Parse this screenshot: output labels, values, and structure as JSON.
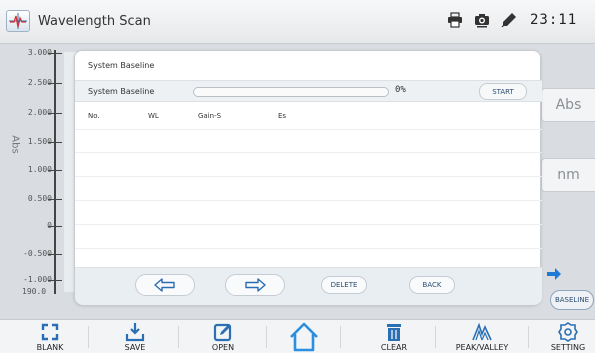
{
  "title_bar": {
    "app_title": "Wavelength Scan",
    "clock": "23:11",
    "status_icons": [
      "printer-icon",
      "camera-icon",
      "pen-icon"
    ]
  },
  "plot": {
    "y_axis_title": "Abs",
    "y_ticks": [
      "3.000",
      "2.500",
      "2.000",
      "1.500",
      "1.000",
      "0.500",
      "0",
      "-0.500",
      "-1.000"
    ],
    "x_tick_start": "190.0"
  },
  "side_panel": {
    "abs_box": "Abs",
    "nm_box": "nm",
    "baseline_button": "BASELINE",
    "arrow_icon": "arrow-right-icon"
  },
  "dialog": {
    "title": "System Baseline",
    "row_label": "System Baseline",
    "progress_percent": 0,
    "progress_text": "0%",
    "start_button": "START",
    "columns": [
      "No.",
      "WL",
      "Gain-S",
      "Es"
    ],
    "rows": [],
    "footer": {
      "prev_icon": "arrow-left-icon",
      "next_icon": "arrow-right-icon",
      "delete_button": "DELETE",
      "back_button": "BACK"
    }
  },
  "toolbar": {
    "items": [
      {
        "label": "BLANK",
        "icon": "blank-icon"
      },
      {
        "label": "SAVE",
        "icon": "save-icon"
      },
      {
        "label": "OPEN",
        "icon": "open-icon"
      },
      {
        "label": "",
        "icon": "home-icon"
      },
      {
        "label": "CLEAR",
        "icon": "trash-icon"
      },
      {
        "label": "PEAK/VALLEY",
        "icon": "peak-valley-icon"
      },
      {
        "label": "SETTING",
        "icon": "gear-icon"
      }
    ]
  },
  "colors": {
    "accent": "#2f6fbf",
    "toolbar_bg": "#f3f4f6",
    "dialog_footer_bg": "#e9eef2"
  }
}
